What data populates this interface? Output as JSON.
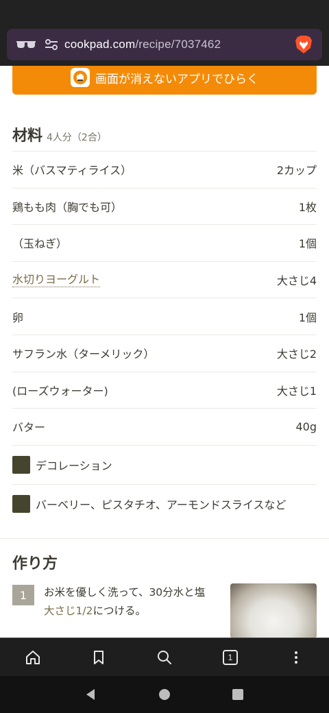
{
  "browser": {
    "url_host": "cookpad.com",
    "url_path": "/recipe/7037462"
  },
  "app_banner": {
    "label": "画面が消えないアプリでひらく"
  },
  "ingredients": {
    "title": "材料",
    "servings": "4人分（2合）",
    "items": [
      {
        "name": "米（バスマティライス）",
        "qty": "2カップ"
      },
      {
        "name": "鶏もも肉（胸でも可）",
        "qty": "1枚"
      },
      {
        "name": "（玉ねぎ）",
        "qty": "1個"
      },
      {
        "name": "水切りヨーグルト",
        "qty": "大さじ4"
      },
      {
        "name": "卵",
        "qty": "1個"
      },
      {
        "name": "サフラン水（ターメリック）",
        "qty": "大さじ2"
      },
      {
        "name": "(ローズウォーター)",
        "qty": "大さじ1"
      },
      {
        "name": "バター",
        "qty": "40g"
      }
    ],
    "groups": [
      {
        "label": "デコレーション"
      },
      {
        "label": "バーベリー、ピスタチオ、アーモンドスライスなど"
      }
    ]
  },
  "steps": {
    "title": "作り方",
    "items": [
      {
        "number": "1",
        "text_main": "お米を優しく洗って、30分水と塩",
        "text_link": "大さじ1/2",
        "text_tail": "につける。"
      }
    ]
  },
  "bottom_nav": {
    "tab_count": "1"
  },
  "colors": {
    "accent": "#f48b08",
    "url_bar": "#3b2c44",
    "link": "#7a6a47"
  }
}
